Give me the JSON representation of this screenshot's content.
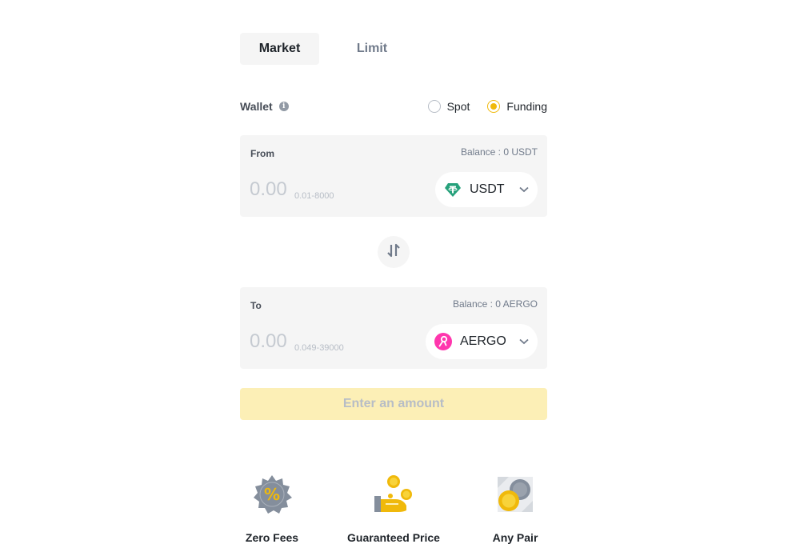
{
  "tabs": [
    {
      "label": "Market",
      "active": true
    },
    {
      "label": "Limit",
      "active": false
    }
  ],
  "wallet": {
    "label": "Wallet",
    "info_icon": "info-icon",
    "options": [
      {
        "label": "Spot",
        "checked": false
      },
      {
        "label": "Funding",
        "checked": true
      }
    ]
  },
  "from": {
    "label": "From",
    "balance": "Balance : 0 USDT",
    "placeholder": "0.00",
    "range": "0.01-8000",
    "coin": "USDT",
    "coin_color": "#26a17b"
  },
  "swap": {
    "icon": "swap-arrows-icon"
  },
  "to": {
    "label": "To",
    "balance": "Balance : 0 AERGO",
    "placeholder": "0.00",
    "range": "0.049-39000",
    "coin": "AERGO",
    "coin_color": "#ff36ad"
  },
  "submit": {
    "label": "Enter an amount"
  },
  "features": [
    {
      "label": "Zero Fees",
      "icon": "percent-badge-icon"
    },
    {
      "label": "Guaranteed Price",
      "icon": "coins-hand-icon"
    },
    {
      "label": "Any Pair",
      "icon": "coin-pair-icon"
    }
  ],
  "colors": {
    "accent": "#f0b90b",
    "panel_bg": "#f5f5f5",
    "button_disabled_bg": "#fcefb6"
  }
}
